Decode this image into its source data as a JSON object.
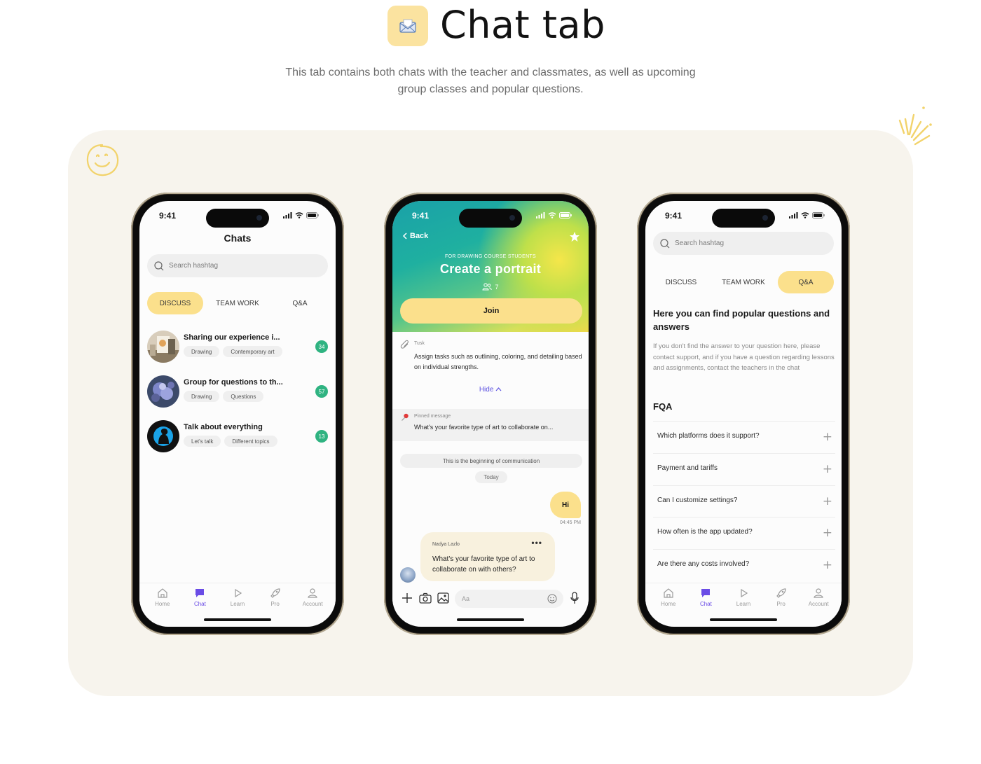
{
  "header": {
    "title": "Chat tab",
    "subtitle": "This tab contains both chats with the teacher and classmates, as well as upcoming group classes and popular questions."
  },
  "status": {
    "time": "9:41"
  },
  "tabbar": [
    {
      "label": "Home",
      "icon": "home-icon"
    },
    {
      "label": "Chat",
      "icon": "chat-icon"
    },
    {
      "label": "Learn",
      "icon": "play-icon"
    },
    {
      "label": "Pro",
      "icon": "rocket-icon"
    },
    {
      "label": "Account",
      "icon": "user-icon"
    }
  ],
  "phone1": {
    "title": "Chats",
    "search_placeholder": "Search hashtag",
    "tabs": [
      "DISCUSS",
      "TEAM WORK",
      "Q&A"
    ],
    "active_tab": "DISCUSS",
    "chats": [
      {
        "title": "Sharing our experience i...",
        "tags": [
          "Drawing",
          "Contemporary art"
        ],
        "count": "34"
      },
      {
        "title": "Group for questions to th...",
        "tags": [
          "Drawing",
          "Questions"
        ],
        "count": "57"
      },
      {
        "title": "Talk about everything",
        "tags": [
          "Let's talk",
          "Different topics"
        ],
        "count": "13"
      }
    ]
  },
  "phone2": {
    "back_label": "Back",
    "for_label": "FOR DRAWING COURSE STUDENTS",
    "course_title": "Create a portrait",
    "members": "7",
    "join_label": "Join",
    "task_label": "Tusk",
    "task_text": "Assign tasks such as outlining, coloring, and detailing based on individual strengths.",
    "hide_label": "Hide",
    "pinned_label": "Pinned message",
    "pinned_text": "What's your favorite type of art to collaborate on...",
    "beginning_label": "This is the beginning of communication",
    "today_label": "Today",
    "outgoing_message": "Hi",
    "outgoing_time": "04:45 PM",
    "incoming_author": "Nadya Lazlo",
    "incoming_text": "What's your favorite type of art to collaborate on with others?",
    "composer_placeholder": "Aa"
  },
  "phone3": {
    "search_placeholder": "Search hashtag",
    "tabs": [
      "DISCUSS",
      "TEAM WORK",
      "Q&A"
    ],
    "active_tab": "Q&A",
    "heading": "Here you can find popular questions and answers",
    "description": "If you don't find the answer to your question here, please contact support, and if you have a question regarding lessons and assignments, contact the teachers in the chat",
    "fqa_title": "FQA",
    "faq": [
      "Which platforms does it support?",
      "Payment and tariffs",
      "Can I customize settings?",
      "How often is the app updated?",
      "Are there any costs involved?"
    ]
  },
  "colors": {
    "accent_yellow": "#fbe08c",
    "badge_green": "#2fb381",
    "active_purple": "#6a4ce6",
    "panel_bg": "#f7f4ed"
  }
}
